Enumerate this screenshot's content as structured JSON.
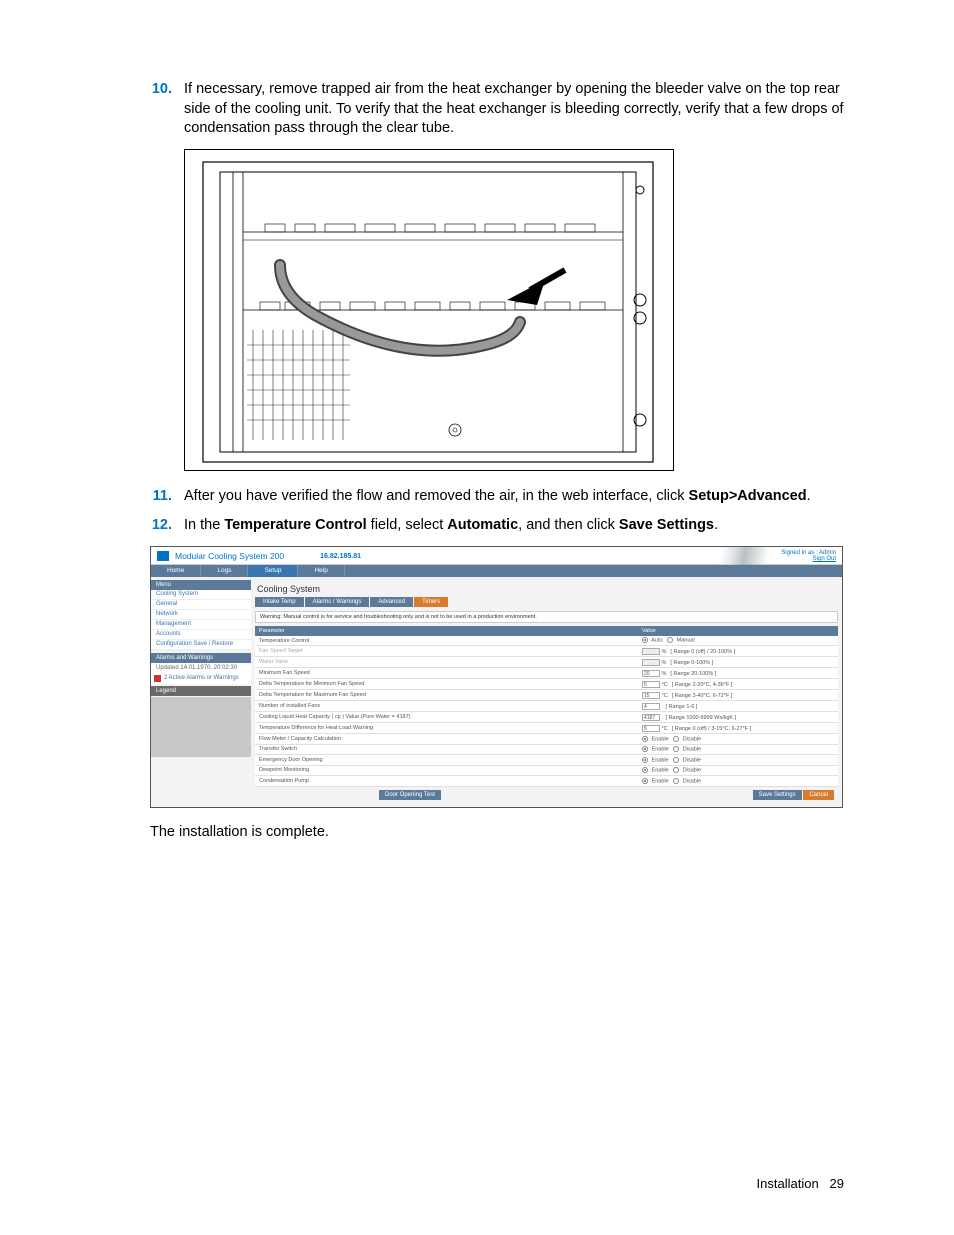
{
  "steps": [
    {
      "num": "10.",
      "parts": [
        {
          "t": "If necessary, remove trapped air from the heat exchanger by opening the bleeder valve on the top rear side of the cooling unit. To verify that the heat exchanger is bleeding correctly, verify that a few drops of condensation pass through the clear tube.",
          "b": false
        }
      ]
    },
    {
      "num": "11.",
      "parts": [
        {
          "t": "After you have verified the flow and removed the air, in the web interface, click ",
          "b": false
        },
        {
          "t": "Setup>Advanced",
          "b": true
        },
        {
          "t": ".",
          "b": false
        }
      ]
    },
    {
      "num": "12.",
      "parts": [
        {
          "t": "In the ",
          "b": false
        },
        {
          "t": "Temperature Control",
          "b": true
        },
        {
          "t": " field, select ",
          "b": false
        },
        {
          "t": "Automatic",
          "b": true
        },
        {
          "t": ", and then click ",
          "b": false
        },
        {
          "t": "Save Settings",
          "b": true
        },
        {
          "t": ".",
          "b": false
        }
      ]
    }
  ],
  "completion": "The installation is complete.",
  "footer": {
    "section": "Installation",
    "page": "29"
  },
  "screenshot": {
    "product": "Modular Cooling System 200",
    "ip": "16.82.185.81",
    "signed": "Signed in as : Admin",
    "signout": "Sign Out",
    "topnav": [
      "Home",
      "Logs",
      "Setup",
      "Help"
    ],
    "topnav_active": 2,
    "menu_head": "Menu",
    "menu_items": [
      "Cooling System",
      "General",
      "Network",
      "Management",
      "Accounts",
      "Configuration Save / Restore"
    ],
    "alarms_head": "Alarms and Warnings",
    "alarms_updated": "Updated 14.01.1970. 20:02:30",
    "alarms_text": "2 Active Alarms or Warnings",
    "legend": "Legend",
    "main_title": "Cooling System",
    "subtabs": [
      "Intake Temp",
      "Alarms / Warnings",
      "Advanced",
      "Timers"
    ],
    "subtabs_active": 2,
    "warning": "Warning: Manual control is for service and troubleshooting only and is not to be used in a production environment.",
    "th_param": "Parameter",
    "th_value": "Value",
    "rows": [
      {
        "p": "Temperature Control",
        "type": "radio2",
        "a": "Auto",
        "b": "Manual",
        "sel": 0
      },
      {
        "p": "Fan Speed Target",
        "type": "input",
        "v": "",
        "unit": "%",
        "range": "[ Range 0 (off) / 20-100% ]",
        "dis": true
      },
      {
        "p": "Water Valve",
        "type": "input",
        "v": "",
        "unit": "%",
        "range": "[ Range 0-100% ]",
        "dis": true
      },
      {
        "p": "Minimum Fan Speed",
        "type": "input",
        "v": "20",
        "unit": "%",
        "range": "[ Range 20-100% ]"
      },
      {
        "p": "Delta Temperature for Minimum Fan Speed",
        "type": "input",
        "v": "5",
        "unit": "°C",
        "range": "[ Range 2-20°C, 4-36°F ]"
      },
      {
        "p": "Delta Temperature for Maximum Fan Speed",
        "type": "input",
        "v": "15",
        "unit": "°C",
        "range": "[ Range 3-40°C, 6-72°F ]"
      },
      {
        "p": "Number of installed Fans",
        "type": "input",
        "v": "4",
        "unit": "",
        "range": "[ Range 1-6 ]"
      },
      {
        "p": "Cooling Liquid Heat Capacity ( cp ) Value (Pure Water = 4187)",
        "type": "input",
        "v": "4187",
        "unit": "",
        "range": "[ Range 1000-9999 Ws/kgK ]"
      },
      {
        "p": "Temperature Difference for Heat Load Warning",
        "type": "input",
        "v": "5",
        "unit": "°C",
        "range": "[ Range 0 (off) / 3-15°C, 6-27°F ]"
      },
      {
        "p": "Flow Meter / Capacity Calculation",
        "type": "radio2",
        "a": "Enable",
        "b": "Disable",
        "sel": 0
      },
      {
        "p": "Transfer Switch",
        "type": "radio2",
        "a": "Enable",
        "b": "Disable",
        "sel": 0
      },
      {
        "p": "Emergency Door Opening",
        "type": "radio2",
        "a": "Enable",
        "b": "Disable",
        "sel": 0
      },
      {
        "p": "Dewpoint Monitoring",
        "type": "radio2",
        "a": "Enable",
        "b": "Disable",
        "sel": 0
      },
      {
        "p": "Condensation Pump",
        "type": "radio2",
        "a": "Enable",
        "b": "Disable",
        "sel": 0
      }
    ],
    "btn_door": "Door Opening Test",
    "btn_save": "Save Settings",
    "btn_cancel": "Cancel"
  }
}
